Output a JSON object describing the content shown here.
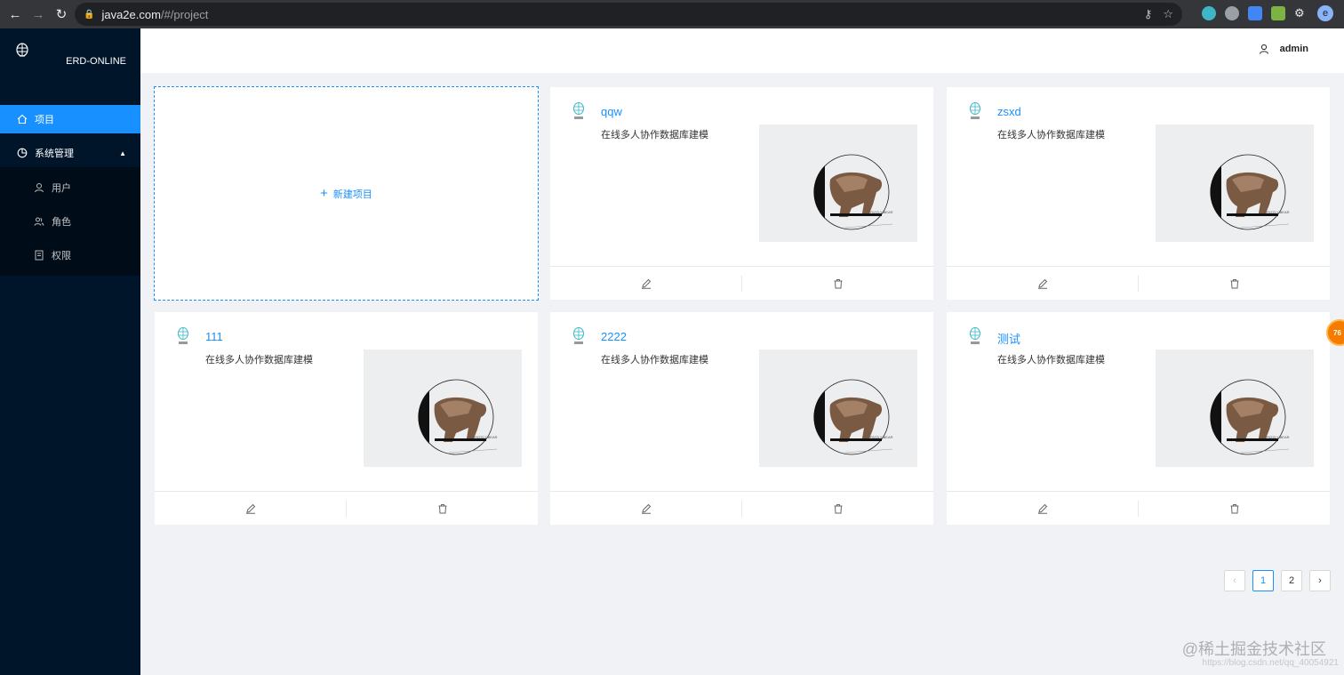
{
  "browser": {
    "url_host": "java2e.com",
    "url_path": "/#/project",
    "profile_initial": "e"
  },
  "sidebar": {
    "app_name": "ERD-ONLINE",
    "items": [
      {
        "label": "项目",
        "icon": "home-icon",
        "active": true
      },
      {
        "label": "系统管理",
        "icon": "pie-chart-icon",
        "expanded": true
      }
    ],
    "sub_items": [
      {
        "label": "用户",
        "icon": "user-icon"
      },
      {
        "label": "角色",
        "icon": "team-icon"
      },
      {
        "label": "权限",
        "icon": "file-icon"
      }
    ]
  },
  "header": {
    "username": "admin"
  },
  "new_project_label": "新建项目",
  "projects": [
    {
      "title": "qqw",
      "description": "在线多人协作数据库建模",
      "image_caption": "GRIZZLY BEAR"
    },
    {
      "title": "zsxd",
      "description": "在线多人协作数据库建模",
      "image_caption": "GRIZZLY BEAR"
    },
    {
      "title": "111",
      "description": "在线多人协作数据库建模",
      "image_caption": "GRIZZLY BEAR"
    },
    {
      "title": "2222",
      "description": "在线多人协作数据库建模",
      "image_caption": "GRIZZLY BEAR"
    },
    {
      "title": "测试",
      "description": "在线多人协作数据库建模",
      "image_caption": "GRIZZLY BEAR"
    }
  ],
  "pagination": {
    "pages": [
      "1",
      "2"
    ],
    "current": "1"
  },
  "float_badge": "76",
  "watermark": "@稀土掘金技术社区",
  "watermark_url": "https://blog.csdn.net/qq_40054921"
}
